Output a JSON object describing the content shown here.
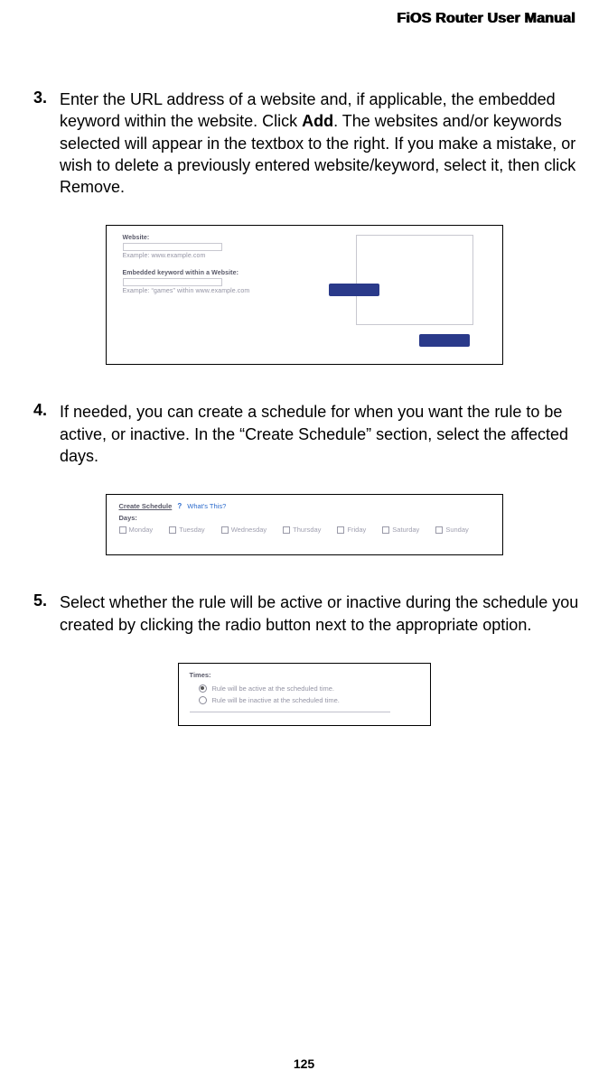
{
  "header": {
    "title": "FiOS Router User Manual"
  },
  "steps": {
    "s3": {
      "num": "3.",
      "text_a": "Enter the URL address of a website and, if applicable, the embedded keyword within the website. Click ",
      "bold": "Add",
      "text_b": ". The websites and/or keywords selected will appear in the textbox to the right. If you make a mistake, or wish to delete a previously entered website/keyword, select it, then click Remove."
    },
    "s4": {
      "num": "4.",
      "text": "If needed, you can create a schedule for when you want the rule to be active, or inactive. In the “Create Schedule” section, select the affected days."
    },
    "s5": {
      "num": "5.",
      "text": "Select whether the rule will be active or inactive during the schedule you created by clicking the radio button next to the appropriate option."
    }
  },
  "fig1": {
    "website_label": "Website:",
    "website_hint": "Example: www.example.com",
    "keyword_label": "Embedded keyword within a Website:",
    "keyword_hint": "Example: “games” within www.example.com"
  },
  "fig2": {
    "title": "Create Schedule",
    "help_text": "What's This?",
    "days_label": "Days:",
    "days": [
      "Monday",
      "Tuesday",
      "Wednesday",
      "Thursday",
      "Friday",
      "Saturday",
      "Sunday"
    ]
  },
  "fig3": {
    "times_label": "Times:",
    "opt_active": "Rule will be active at the scheduled time.",
    "opt_inactive": "Rule will be inactive at the scheduled time."
  },
  "footer": {
    "page_number": "125"
  }
}
